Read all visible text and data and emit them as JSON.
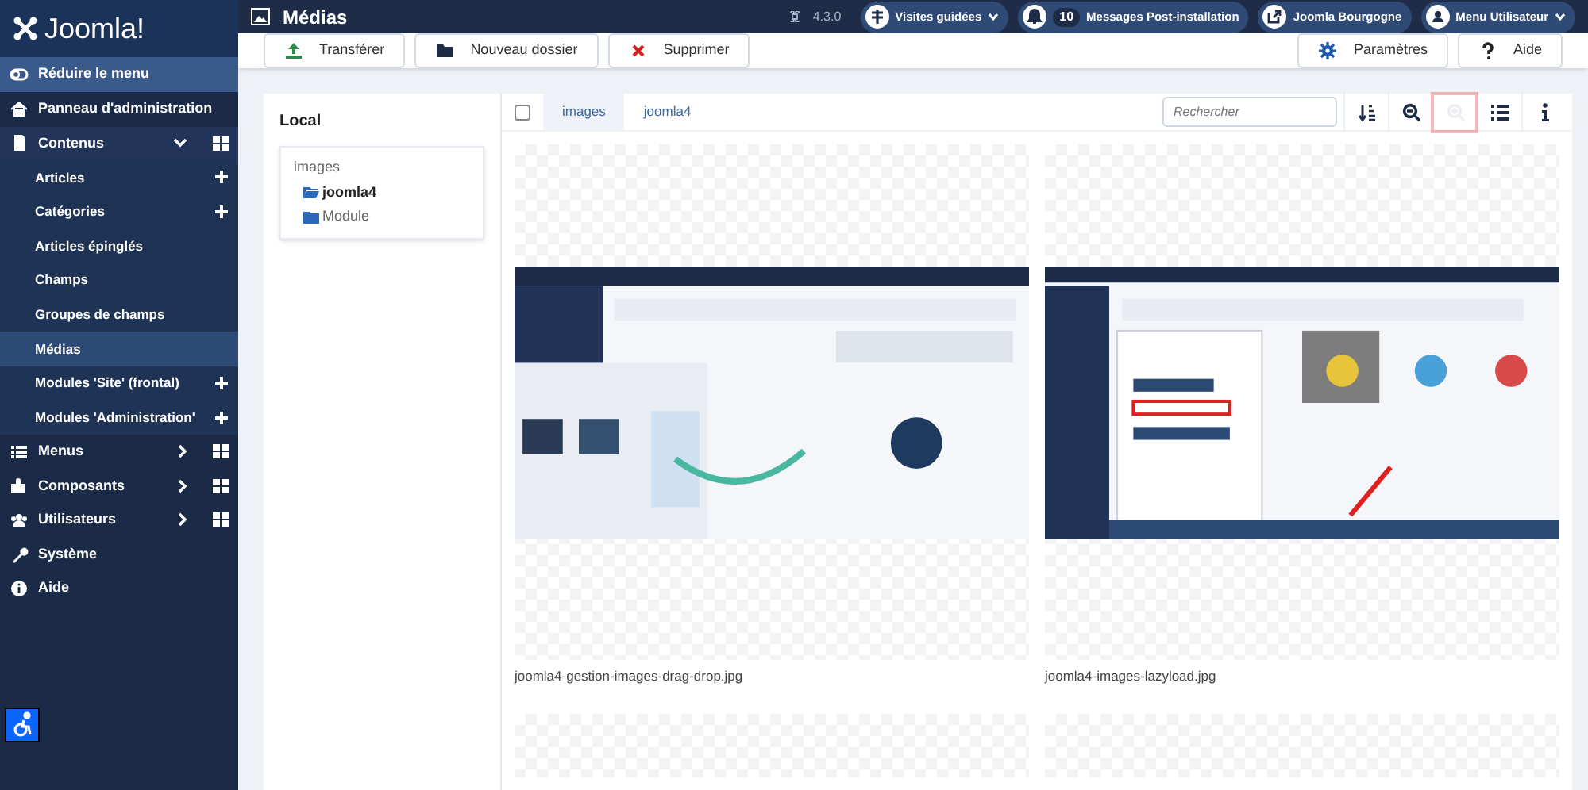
{
  "sidebar": {
    "logo": "Joomla!",
    "collapse": "Réduire le menu",
    "items": [
      {
        "label": "Panneau d'administration",
        "selected": false
      },
      {
        "label": "Contenus",
        "selected": false,
        "expanded": true,
        "children": [
          {
            "label": "Articles",
            "selected": false,
            "addable": true
          },
          {
            "label": "Catégories",
            "selected": false,
            "addable": true
          },
          {
            "label": "Articles épinglés",
            "selected": false,
            "addable": false
          },
          {
            "label": "Champs",
            "selected": false,
            "addable": false
          },
          {
            "label": "Groupes de champs",
            "selected": false,
            "addable": false
          },
          {
            "label": "Médias",
            "selected": true,
            "addable": false
          },
          {
            "label": "Modules 'Site' (frontal)",
            "selected": false,
            "addable": true
          },
          {
            "label": "Modules 'Administration'",
            "selected": false,
            "addable": true
          }
        ]
      },
      {
        "label": "Menus",
        "selected": false,
        "expanded": false
      },
      {
        "label": "Composants",
        "selected": false,
        "expanded": false
      },
      {
        "label": "Utilisateurs",
        "selected": false,
        "expanded": false
      },
      {
        "label": "Système",
        "selected": false
      },
      {
        "label": "Aide",
        "selected": false
      }
    ]
  },
  "header": {
    "title": "Médias",
    "version": "4.3.0",
    "buttons": [
      {
        "label": "Visites guidées",
        "caret": true
      },
      {
        "label": "Messages Post-installation",
        "count": "10"
      },
      {
        "label": "Joomla Bourgogne"
      },
      {
        "label": "Menu Utilisateur",
        "caret": true
      }
    ]
  },
  "toolbar": {
    "left": [
      "Transférer",
      "Nouveau dossier",
      "Supprimer"
    ],
    "right": [
      "Paramètres",
      "Aide"
    ]
  },
  "tree": {
    "title": "Local",
    "root": "images",
    "folders": [
      {
        "label": "joomla4",
        "selected": true
      },
      {
        "label": "Module",
        "selected": false
      }
    ]
  },
  "browser": {
    "breadcrumbs": [
      "images",
      "joomla4"
    ],
    "select_all_checked": false,
    "search_placeholder": "Rechercher",
    "tools": [
      {
        "kind": "sort",
        "disabled": false,
        "highlighted": false
      },
      {
        "kind": "zoom-out",
        "disabled": false,
        "highlighted": false
      },
      {
        "kind": "zoom-in",
        "disabled": true,
        "highlighted": true
      },
      {
        "kind": "list",
        "disabled": false,
        "highlighted": false
      },
      {
        "kind": "info",
        "disabled": false,
        "highlighted": false
      }
    ],
    "files": [
      {
        "kind": "picture",
        "name": "joomla4-gestion-images-drag-drop.jpg"
      },
      {
        "kind": "picture",
        "name": "joomla4-images-lazyload.jpg"
      }
    ]
  }
}
